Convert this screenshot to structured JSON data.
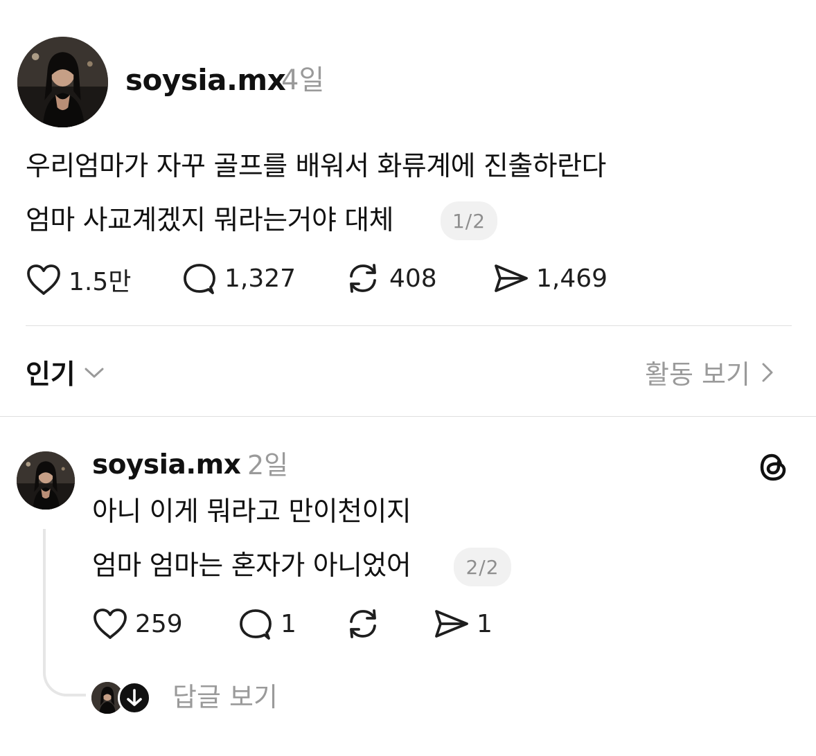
{
  "post": {
    "username": "soysia.mx",
    "time": "4일",
    "lines": [
      "우리엄마가 자꾸 골프를 배워서 화류계에 진출하란다",
      "엄마 사교계겠지 뭐라는거야 대체"
    ],
    "page_indicator": "1/2",
    "likes": "1.5만",
    "comments": "1,327",
    "reposts": "408",
    "shares": "1,469"
  },
  "sort": {
    "label": "인기",
    "activity_label": "활동 보기"
  },
  "reply": {
    "username": "soysia.mx",
    "time": "2일",
    "lines": [
      "아니 이게 뭐라고 만이천이지",
      "엄마 엄마는 혼자가 아니었어"
    ],
    "page_indicator": "2/2",
    "likes": "259",
    "comments": "1",
    "reposts": "",
    "shares": "1",
    "view_replies_label": "답글 보기"
  },
  "icons": {
    "like": "heart-icon",
    "comment": "speech-bubble-icon",
    "repost": "repost-arrows-icon",
    "share": "paper-plane-icon",
    "sort_toggle": "chevron-down-icon",
    "activity": "chevron-right-icon",
    "threads": "threads-logo-icon",
    "view_replies": "arrow-down-icon"
  },
  "colors": {
    "text": "#111111",
    "muted": "#9a9a9a",
    "pill_bg": "#f1f1f1",
    "divider": "#dfdfdf"
  }
}
